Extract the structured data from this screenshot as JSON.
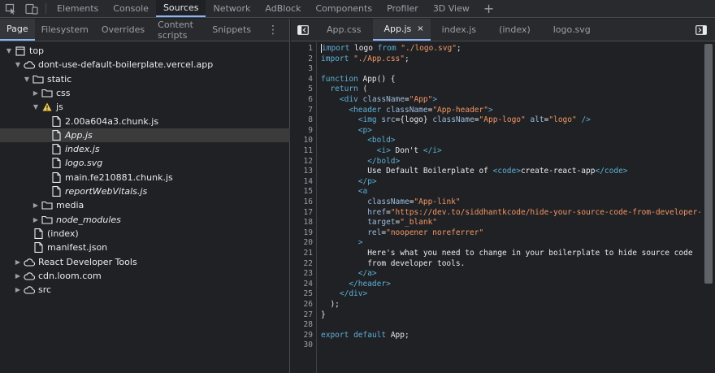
{
  "topbar": {
    "icons": [
      "inspect-icon",
      "device-toolbar-icon"
    ],
    "tabs": [
      {
        "label": "Elements",
        "active": false
      },
      {
        "label": "Console",
        "active": false
      },
      {
        "label": "Sources",
        "active": true
      },
      {
        "label": "Network",
        "active": false
      },
      {
        "label": "AdBlock",
        "active": false
      },
      {
        "label": "Components",
        "active": false
      },
      {
        "label": "Profiler",
        "active": false
      },
      {
        "label": "3D View",
        "active": false
      }
    ],
    "plus_label": "+"
  },
  "navigator": {
    "tabs": [
      {
        "label": "Page",
        "active": true
      },
      {
        "label": "Filesystem",
        "active": false
      },
      {
        "label": "Overrides",
        "active": false
      },
      {
        "label": "Content scripts",
        "active": false
      },
      {
        "label": "Snippets",
        "active": false
      }
    ],
    "more_label": "⋮",
    "tree": [
      {
        "label": "top",
        "icon": "frame-icon",
        "arrow": "down",
        "level": 0
      },
      {
        "label": "dont-use-default-boilerplate.vercel.app",
        "icon": "cloud-icon",
        "arrow": "down",
        "level": 1
      },
      {
        "label": "static",
        "icon": "folder-icon",
        "arrow": "down",
        "level": 2
      },
      {
        "label": "css",
        "icon": "folder-icon",
        "arrow": "right",
        "level": 3
      },
      {
        "label": "js",
        "icon": "warning-icon",
        "arrow": "down",
        "level": 3
      },
      {
        "label": "2.00a604a3.chunk.js",
        "icon": "file-icon",
        "arrow": "none",
        "level": 4,
        "italic": false
      },
      {
        "label": "App.js",
        "icon": "file-icon",
        "arrow": "none",
        "level": 4,
        "italic": true,
        "selected": true
      },
      {
        "label": "index.js",
        "icon": "file-icon",
        "arrow": "none",
        "level": 4,
        "italic": true
      },
      {
        "label": "logo.svg",
        "icon": "file-icon",
        "arrow": "none",
        "level": 4,
        "italic": true
      },
      {
        "label": "main.fe210881.chunk.js",
        "icon": "file-icon",
        "arrow": "none",
        "level": 4,
        "italic": false
      },
      {
        "label": "reportWebVitals.js",
        "icon": "file-icon",
        "arrow": "none",
        "level": 4,
        "italic": true
      },
      {
        "label": "media",
        "icon": "folder-icon",
        "arrow": "right",
        "level": 3
      },
      {
        "label": "node_modules",
        "icon": "folder-icon",
        "arrow": "right",
        "level": 3,
        "italic": true
      },
      {
        "label": "(index)",
        "icon": "file-icon",
        "arrow": "none",
        "level": 2
      },
      {
        "label": "manifest.json",
        "icon": "file-icon",
        "arrow": "none",
        "level": 2
      },
      {
        "label": "React Developer Tools",
        "icon": "cloud-icon",
        "arrow": "right",
        "level": 1
      },
      {
        "label": "cdn.loom.com",
        "icon": "cloud-icon",
        "arrow": "right",
        "level": 1
      },
      {
        "label": "src",
        "icon": "cloud-icon",
        "arrow": "right",
        "level": 1
      }
    ]
  },
  "editor": {
    "tabs": [
      {
        "label": "App.css",
        "active": false
      },
      {
        "label": "App.js",
        "active": true,
        "close": "×"
      },
      {
        "label": "index.js",
        "active": false
      },
      {
        "label": "(index)",
        "active": false
      },
      {
        "label": "logo.svg",
        "active": false
      }
    ],
    "lines": [
      [
        [
          "kw",
          "import"
        ],
        [
          "plain",
          " logo "
        ],
        [
          "kw",
          "from"
        ],
        [
          "plain",
          " "
        ],
        [
          "str",
          "\"./logo.svg\""
        ],
        [
          "plain",
          ";"
        ]
      ],
      [
        [
          "kw",
          "import"
        ],
        [
          "plain",
          " "
        ],
        [
          "str",
          "\"./App.css\""
        ],
        [
          "plain",
          ";"
        ]
      ],
      [],
      [
        [
          "kw",
          "function"
        ],
        [
          "plain",
          " App() {"
        ]
      ],
      [
        [
          "plain",
          "  "
        ],
        [
          "kw",
          "return"
        ],
        [
          "plain",
          " ("
        ]
      ],
      [
        [
          "plain",
          "    "
        ],
        [
          "tag",
          "<div"
        ],
        [
          "plain",
          " "
        ],
        [
          "attr",
          "className"
        ],
        [
          "plain",
          "="
        ],
        [
          "str",
          "\"App\""
        ],
        [
          "tag",
          ">"
        ]
      ],
      [
        [
          "plain",
          "      "
        ],
        [
          "tag",
          "<header"
        ],
        [
          "plain",
          " "
        ],
        [
          "attr",
          "className"
        ],
        [
          "plain",
          "="
        ],
        [
          "str",
          "\"App-header\""
        ],
        [
          "tag",
          ">"
        ]
      ],
      [
        [
          "plain",
          "        "
        ],
        [
          "tag",
          "<img"
        ],
        [
          "plain",
          " "
        ],
        [
          "attr",
          "src"
        ],
        [
          "plain",
          "={logo} "
        ],
        [
          "attr",
          "className"
        ],
        [
          "plain",
          "="
        ],
        [
          "str",
          "\"App-logo\""
        ],
        [
          "plain",
          " "
        ],
        [
          "attr",
          "alt"
        ],
        [
          "plain",
          "="
        ],
        [
          "str",
          "\"logo\""
        ],
        [
          "plain",
          " "
        ],
        [
          "tag",
          "/>"
        ]
      ],
      [
        [
          "plain",
          "        "
        ],
        [
          "tag",
          "<p>"
        ]
      ],
      [
        [
          "plain",
          "          "
        ],
        [
          "tag",
          "<bold>"
        ]
      ],
      [
        [
          "plain",
          "            "
        ],
        [
          "tag",
          "<i>"
        ],
        [
          "plain",
          " Don't "
        ],
        [
          "tag",
          "</i>"
        ]
      ],
      [
        [
          "plain",
          "          "
        ],
        [
          "tag",
          "</bold>"
        ]
      ],
      [
        [
          "plain",
          "          Use Default Boilerplate of "
        ],
        [
          "tag",
          "<code>"
        ],
        [
          "plain",
          "create-react-app"
        ],
        [
          "tag",
          "</code>"
        ]
      ],
      [
        [
          "plain",
          "        "
        ],
        [
          "tag",
          "</p>"
        ]
      ],
      [
        [
          "plain",
          "        "
        ],
        [
          "tag",
          "<a"
        ]
      ],
      [
        [
          "plain",
          "          "
        ],
        [
          "attr",
          "className"
        ],
        [
          "plain",
          "="
        ],
        [
          "str",
          "\"App-link\""
        ]
      ],
      [
        [
          "plain",
          "          "
        ],
        [
          "attr",
          "href"
        ],
        [
          "plain",
          "="
        ],
        [
          "str",
          "\"https://dev.to/siddhantkcode/hide-your-source-code-from-developer-"
        ]
      ],
      [
        [
          "plain",
          "          "
        ],
        [
          "attr",
          "target"
        ],
        [
          "plain",
          "="
        ],
        [
          "str",
          "\"_blank\""
        ]
      ],
      [
        [
          "plain",
          "          "
        ],
        [
          "attr",
          "rel"
        ],
        [
          "plain",
          "="
        ],
        [
          "str",
          "\"noopener noreferrer\""
        ]
      ],
      [
        [
          "plain",
          "        "
        ],
        [
          "tag",
          ">"
        ]
      ],
      [
        [
          "plain",
          "          Here's what you need to change in your boilerplate to hide source code"
        ]
      ],
      [
        [
          "plain",
          "          from developer tools."
        ]
      ],
      [
        [
          "plain",
          "        "
        ],
        [
          "tag",
          "</a>"
        ]
      ],
      [
        [
          "plain",
          "      "
        ],
        [
          "tag",
          "</header>"
        ]
      ],
      [
        [
          "plain",
          "    "
        ],
        [
          "tag",
          "</div>"
        ]
      ],
      [
        [
          "plain",
          "  );"
        ]
      ],
      [
        [
          "plain",
          "}"
        ]
      ],
      [],
      [
        [
          "kw",
          "export"
        ],
        [
          "plain",
          " "
        ],
        [
          "kw",
          "default"
        ],
        [
          "plain",
          " App;"
        ]
      ],
      []
    ],
    "line_numbers": [
      "1",
      "2",
      "3",
      "4",
      "5",
      "6",
      "7",
      "8",
      "9",
      "10",
      "11",
      "12",
      "13",
      "14",
      "15",
      "16",
      "17",
      "18",
      "19",
      "20",
      "21",
      "22",
      "23",
      "24",
      "25",
      "26",
      "27",
      "28",
      "29",
      "30"
    ]
  },
  "colors": {
    "accent": "#8ab4f8",
    "keyword": "#5db0d7",
    "string": "#f29766",
    "background": "#202124"
  }
}
